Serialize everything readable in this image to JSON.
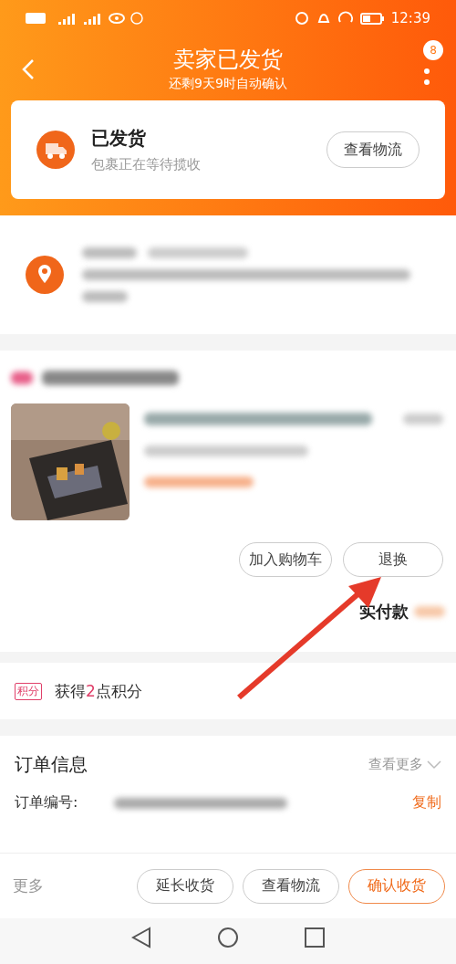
{
  "status_bar": {
    "time": "12:39"
  },
  "header": {
    "title": "卖家已发货",
    "subtitle": "还剩9天9时自动确认",
    "badge": "8"
  },
  "shipping_card": {
    "title": "已发货",
    "subtitle": "包裹正在等待揽收",
    "button": "查看物流"
  },
  "product_actions": [
    "加入购物车",
    "退换"
  ],
  "paid_label": "实付款",
  "points": {
    "tag": "积分",
    "text": "获得**2**点积分"
  },
  "order_info": {
    "title": "订单信息",
    "more": "查看更多",
    "order_number_label": "订单编号:",
    "copy": "复制"
  },
  "footer": {
    "more": "更多",
    "buttons": [
      {
        "label": "延长收货",
        "primary": false
      },
      {
        "label": "查看物流",
        "primary": false
      },
      {
        "label": "确认收货",
        "primary": true
      }
    ]
  }
}
